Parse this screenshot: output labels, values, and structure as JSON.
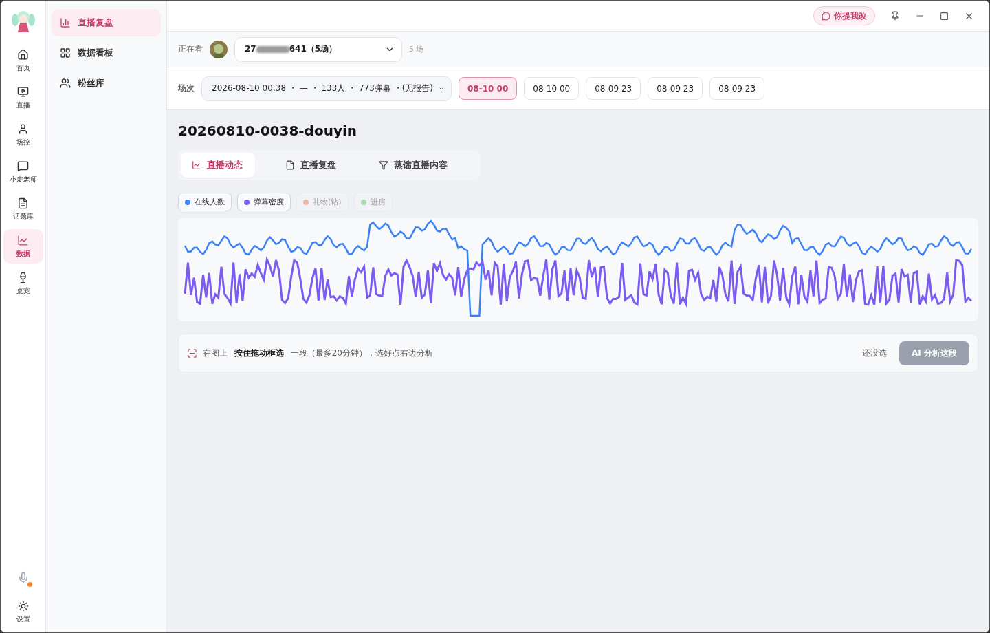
{
  "titlebar": {
    "feedback_button": "你提我改"
  },
  "rail": {
    "items": [
      {
        "label": "首页",
        "selected": false
      },
      {
        "label": "直播",
        "selected": false
      },
      {
        "label": "场控",
        "selected": false
      },
      {
        "label": "小麦老师",
        "selected": false
      },
      {
        "label": "话题库",
        "selected": false
      },
      {
        "label": "数据",
        "selected": true
      },
      {
        "label": "桌宠",
        "selected": false
      }
    ],
    "settings": {
      "label": "设置"
    },
    "mic": {
      "recording": true
    }
  },
  "subnav": {
    "items": [
      {
        "label": "直播复盘",
        "selected": true
      },
      {
        "label": "数据看板",
        "selected": false
      },
      {
        "label": "粉丝库",
        "selected": false
      }
    ]
  },
  "watching": {
    "label": "正在看",
    "account_prefix": "27",
    "account_suffix": "641（5场）",
    "count": "5 场"
  },
  "session": {
    "label": "场次",
    "value": "2026-08-10 00:38 ・ — ・ 133人 ・ 773弹幕 ・(无报告)",
    "chips": [
      {
        "label": "08-10 00",
        "selected": true
      },
      {
        "label": "08-10 00",
        "selected": false
      },
      {
        "label": "08-09 23",
        "selected": false
      },
      {
        "label": "08-09 23",
        "selected": false
      },
      {
        "label": "08-09 23",
        "selected": false
      }
    ]
  },
  "title": "20260810-0038-douyin",
  "tabs": [
    {
      "label": "直播动态",
      "selected": true
    },
    {
      "label": "直播复盘",
      "selected": false
    },
    {
      "label": "蒸馏直播内容",
      "selected": false
    }
  ],
  "legend": [
    {
      "label": "在线人数",
      "color": "#3b82f6",
      "on": true
    },
    {
      "label": "弹幕密度",
      "color": "#7c5cf0",
      "on": true
    },
    {
      "label": "礼物(钻)",
      "color": "#f0b4a8",
      "on": false
    },
    {
      "label": "进房",
      "color": "#a6dcb0",
      "on": false
    }
  ],
  "hint": {
    "text": "在图上 **按住拖动框选** 一段（最多20分钟），选好点右边分析",
    "clear": "还没选",
    "analyze_button": "AI 分析这段",
    "analyze_disabled": true
  }
}
